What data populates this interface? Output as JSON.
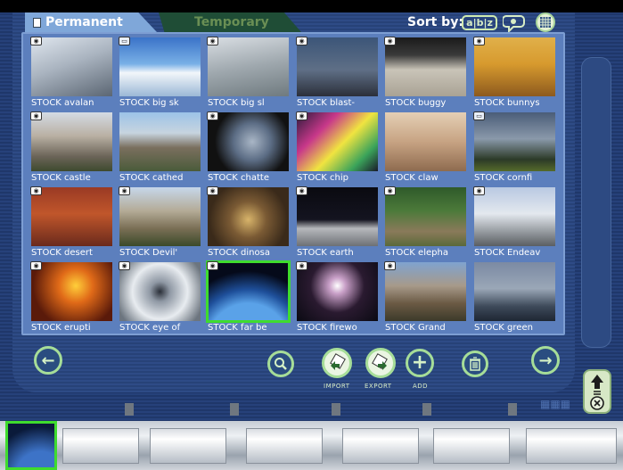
{
  "tabs": {
    "permanent": "Permanent",
    "temporary": "Temporary"
  },
  "sort": {
    "label": "Sort by:",
    "alpha_icon_text": "a|b|z"
  },
  "thumbnails": [
    {
      "caption": "STOCK avalan",
      "badge": "cam"
    },
    {
      "caption": "STOCK big sk",
      "badge": "img"
    },
    {
      "caption": "STOCK big sl",
      "badge": "cam"
    },
    {
      "caption": "STOCK blast-",
      "badge": "cam"
    },
    {
      "caption": "STOCK buggy",
      "badge": "cam"
    },
    {
      "caption": "STOCK bunnys",
      "badge": "cam"
    },
    {
      "caption": "STOCK castle",
      "badge": "cam"
    },
    {
      "caption": "STOCK cathed",
      "badge": ""
    },
    {
      "caption": "STOCK chatte",
      "badge": "cam"
    },
    {
      "caption": "STOCK chip",
      "badge": "cam"
    },
    {
      "caption": "STOCK claw",
      "badge": ""
    },
    {
      "caption": "STOCK cornfi",
      "badge": "img"
    },
    {
      "caption": "STOCK desert",
      "badge": "cam"
    },
    {
      "caption": "STOCK Devil'",
      "badge": "cam"
    },
    {
      "caption": "STOCK dinosa",
      "badge": "cam"
    },
    {
      "caption": "STOCK earth",
      "badge": "cam"
    },
    {
      "caption": "STOCK elepha",
      "badge": "cam"
    },
    {
      "caption": "STOCK Endeav",
      "badge": "cam"
    },
    {
      "caption": "STOCK erupti",
      "badge": "cam"
    },
    {
      "caption": "STOCK eye of",
      "badge": "cam"
    },
    {
      "caption": "STOCK far be",
      "badge": "cam",
      "selected": true
    },
    {
      "caption": "STOCK firewo",
      "badge": "cam"
    },
    {
      "caption": "STOCK Grand",
      "badge": "cam"
    },
    {
      "caption": "STOCK green",
      "badge": ""
    }
  ],
  "actions": {
    "import_label": "IMPORT",
    "export_label": "EXPORT",
    "add_label": "ADD"
  },
  "colors": {
    "accent_green": "#3fdc2e",
    "panel_blue": "#5c7fbd",
    "tab_active": "#7fa7d9",
    "tab_inactive": "#1f4d36"
  }
}
